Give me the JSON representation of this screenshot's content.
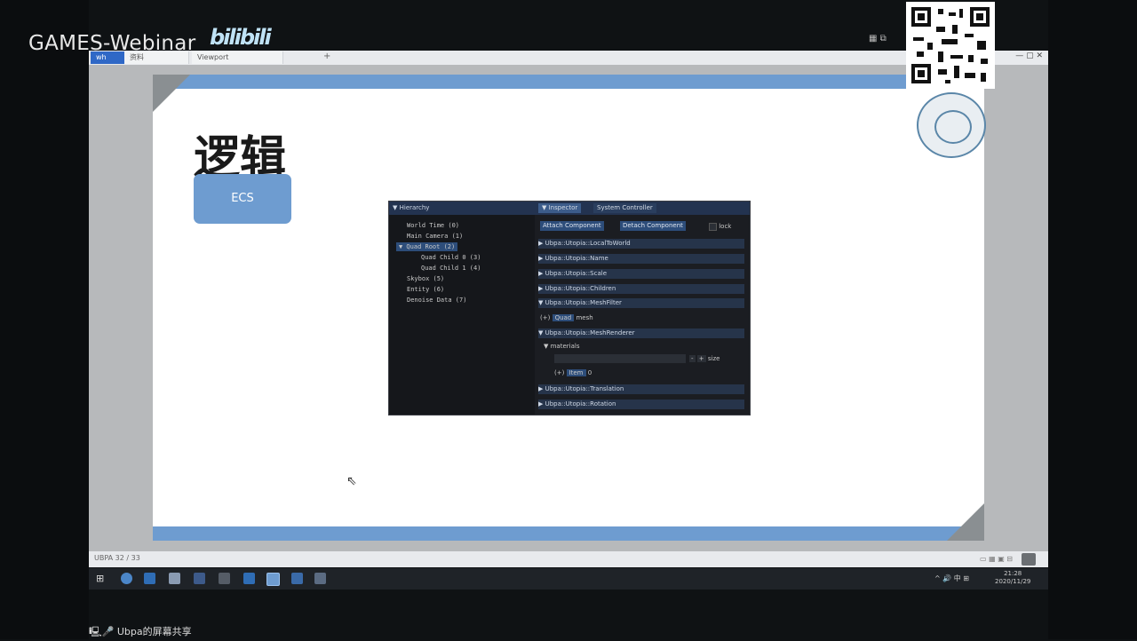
{
  "watermark": {
    "text": "GAMES-Webinar",
    "logo": "bilibili"
  },
  "browser": {
    "tabs": [
      "wh",
      "资料",
      "Viewport"
    ],
    "new_tab": "+",
    "window_controls": "— ▢ ✕"
  },
  "slide": {
    "title": "逻辑",
    "box_label": "ECS"
  },
  "editor": {
    "hierarchy": {
      "header": "▼ Hierarchy",
      "items": [
        {
          "label": "World Time (0)"
        },
        {
          "label": "Main Camera (1)"
        },
        {
          "label": "▼ Quad Root (2)"
        },
        {
          "label": "Quad Child 0 (3)"
        },
        {
          "label": "Quad Child 1 (4)"
        },
        {
          "label": "Skybox (5)"
        },
        {
          "label": "Entity (6)"
        },
        {
          "label": "Denoise Data (7)"
        }
      ]
    },
    "inspector": {
      "tabs": [
        "▼ Inspector",
        "System Controller"
      ],
      "buttons": {
        "attach": "Attach Component",
        "detach": "Detach Component",
        "lock": "lock"
      },
      "components": [
        "▶ Ubpa::Utopia::LocalToWorld",
        "▶ Ubpa::Utopia::Name",
        "▶ Ubpa::Utopia::Scale",
        "▶ Ubpa::Utopia::Children",
        "▼ Ubpa::Utopia::MeshFilter"
      ],
      "mesh_row": {
        "prefix": "(+)",
        "value": "Quad",
        "label": "mesh"
      },
      "renderer": "▼ Ubpa::Utopia::MeshRenderer",
      "materials_label": "▼ materials",
      "size_label": "size",
      "item_row": {
        "prefix": "(+)",
        "value": "Item",
        "index": "0"
      },
      "tail_components": [
        "▶ Ubpa::Utopia::Translation",
        "▶ Ubpa::Utopia::Rotation"
      ]
    }
  },
  "statusbar": {
    "text": "UBPA 32 / 33"
  },
  "clock": {
    "time": "21:28",
    "date": "2020/11/29"
  },
  "tray": {
    "text": "^ 🔊 中 ⊞"
  },
  "share_label": "Ubpa的屏幕共享",
  "colors": {
    "accent": "#6e9cd0",
    "editor_bg": "#15171b",
    "header_blue": "#233350"
  }
}
